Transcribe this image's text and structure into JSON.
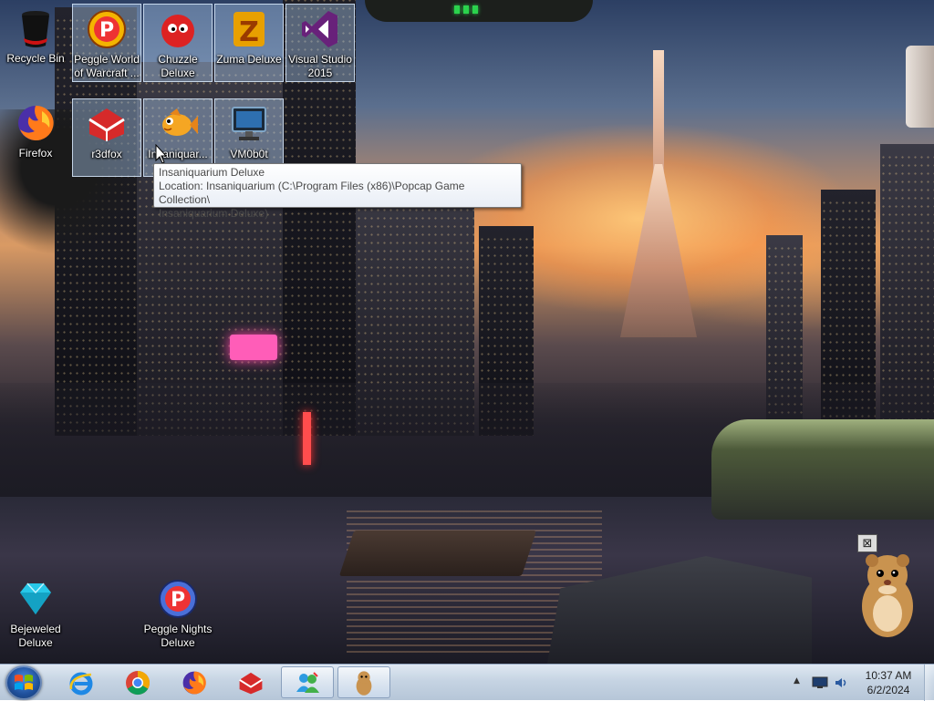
{
  "desktop": {
    "icons": [
      {
        "id": "recycle-bin",
        "label": "Recycle Bin",
        "icon": "recycle-bin-icon"
      },
      {
        "id": "peggle-wow",
        "label": "Peggle World of Warcraft ...",
        "icon": "peggle-icon"
      },
      {
        "id": "chuzzle",
        "label": "Chuzzle Deluxe",
        "icon": "chuzzle-icon"
      },
      {
        "id": "zuma",
        "label": "Zuma Deluxe",
        "icon": "zuma-icon"
      },
      {
        "id": "visual-studio",
        "label": "Visual Studio 2015",
        "icon": "visual-studio-icon"
      },
      {
        "id": "firefox",
        "label": "Firefox",
        "icon": "firefox-icon"
      },
      {
        "id": "r3dfox",
        "label": "r3dfox",
        "icon": "r3dfox-icon"
      },
      {
        "id": "insaniquarium",
        "label": "Insaniquar...",
        "icon": "insaniquarium-fish-icon"
      },
      {
        "id": "vm0b0t",
        "label": "VM0b0t",
        "icon": "monitor-icon"
      },
      {
        "id": "bejeweled",
        "label": "Bejeweled Deluxe",
        "icon": "diamond-icon"
      },
      {
        "id": "peggle-nights",
        "label": "Peggle Nights Deluxe",
        "icon": "peggle-icon"
      }
    ],
    "tooltip": {
      "line1": "Insaniquarium Deluxe",
      "line2": "Location: Insaniquarium (C:\\Program Files (x86)\\Popcap Game Collection\\",
      "line3": "Insaniquarium Deluxe)"
    }
  },
  "taskbar": {
    "start_icon": "windows-start-orb-icon",
    "pinned": [
      {
        "name": "internet-explorer",
        "icon": "internet-explorer-icon"
      },
      {
        "name": "chrome",
        "icon": "chrome-icon"
      },
      {
        "name": "firefox",
        "icon": "firefox-icon"
      },
      {
        "name": "r3dfox",
        "icon": "r3dfox-icon"
      },
      {
        "name": "messenger",
        "icon": "people-icon",
        "active": true
      },
      {
        "name": "hamster-app",
        "icon": "hamster-icon",
        "active": true
      }
    ],
    "tray": {
      "time": "10:37 AM",
      "date": "6/2/2024"
    }
  },
  "gadget": {
    "close_symbol": "⊠"
  },
  "colors": {
    "taskbar_top": "#dfe8f2",
    "taskbar_bottom": "#b6c6d8",
    "selection": "#aac8eb",
    "tooltip_text": "#4a4a4a",
    "vs_purple": "#68217a"
  }
}
